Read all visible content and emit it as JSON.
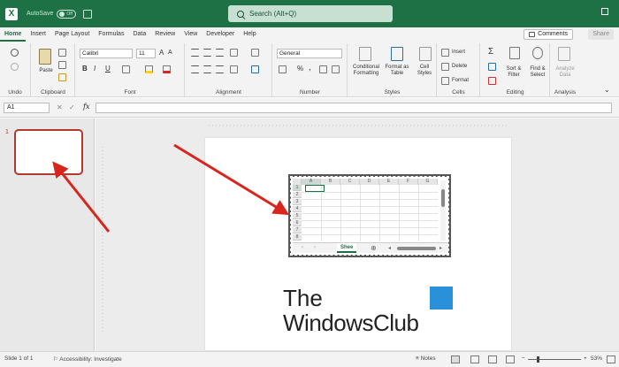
{
  "titlebar": {
    "autosave_label": "AutoSave",
    "autosave_state": "Off",
    "search_placeholder": "Search (Alt+Q)"
  },
  "tabs": [
    "Home",
    "Insert",
    "Page Layout",
    "Formulas",
    "Data",
    "Review",
    "View",
    "Developer",
    "Help"
  ],
  "header_buttons": {
    "comments": "Comments",
    "share": "Share"
  },
  "ribbon": {
    "groups": {
      "undo": "Undo",
      "clipboard": "Clipboard",
      "font": "Font",
      "alignment": "Alignment",
      "number": "Number",
      "styles": "Styles",
      "cells": "Cells",
      "editing": "Editing",
      "analysis": "Analysis"
    },
    "paste": "Paste",
    "font_name": "Calibri",
    "font_size": "11",
    "number_format": "General",
    "conditional_formatting": [
      "Conditional",
      "Formatting"
    ],
    "format_as_table": [
      "Format as",
      "Table"
    ],
    "cell_styles": [
      "Cell",
      "Styles"
    ],
    "insert": "Insert",
    "delete": "Delete",
    "format": "Format",
    "sort_filter": [
      "Sort &",
      "Filter"
    ],
    "find_select": [
      "Find &",
      "Select"
    ],
    "analyze_data": [
      "Analyze",
      "Data"
    ],
    "bold": "B",
    "italic": "I",
    "underline": "U",
    "percent": "%",
    "comma": ","
  },
  "formula_bar": {
    "name_box": "A1",
    "fx": "fx"
  },
  "slide_panel": {
    "slide_number": "1"
  },
  "embedded_sheet": {
    "columns": [
      "A",
      "B",
      "C",
      "D",
      "E",
      "F",
      "G"
    ],
    "rows": [
      "1",
      "2",
      "3",
      "4",
      "5",
      "6",
      "7",
      "8"
    ],
    "sheet_tab": "Shee"
  },
  "logo": {
    "line1": "The",
    "line2": "WindowsClub"
  },
  "status_bar": {
    "slide_info": "Slide 1 of 1",
    "accessibility": "Accessibility: Investigate",
    "notes": "Notes",
    "zoom": "53%"
  },
  "colors": {
    "accent": "#1e7145",
    "arrow": "#d8261e",
    "logo_blue": "#2a90d9"
  }
}
